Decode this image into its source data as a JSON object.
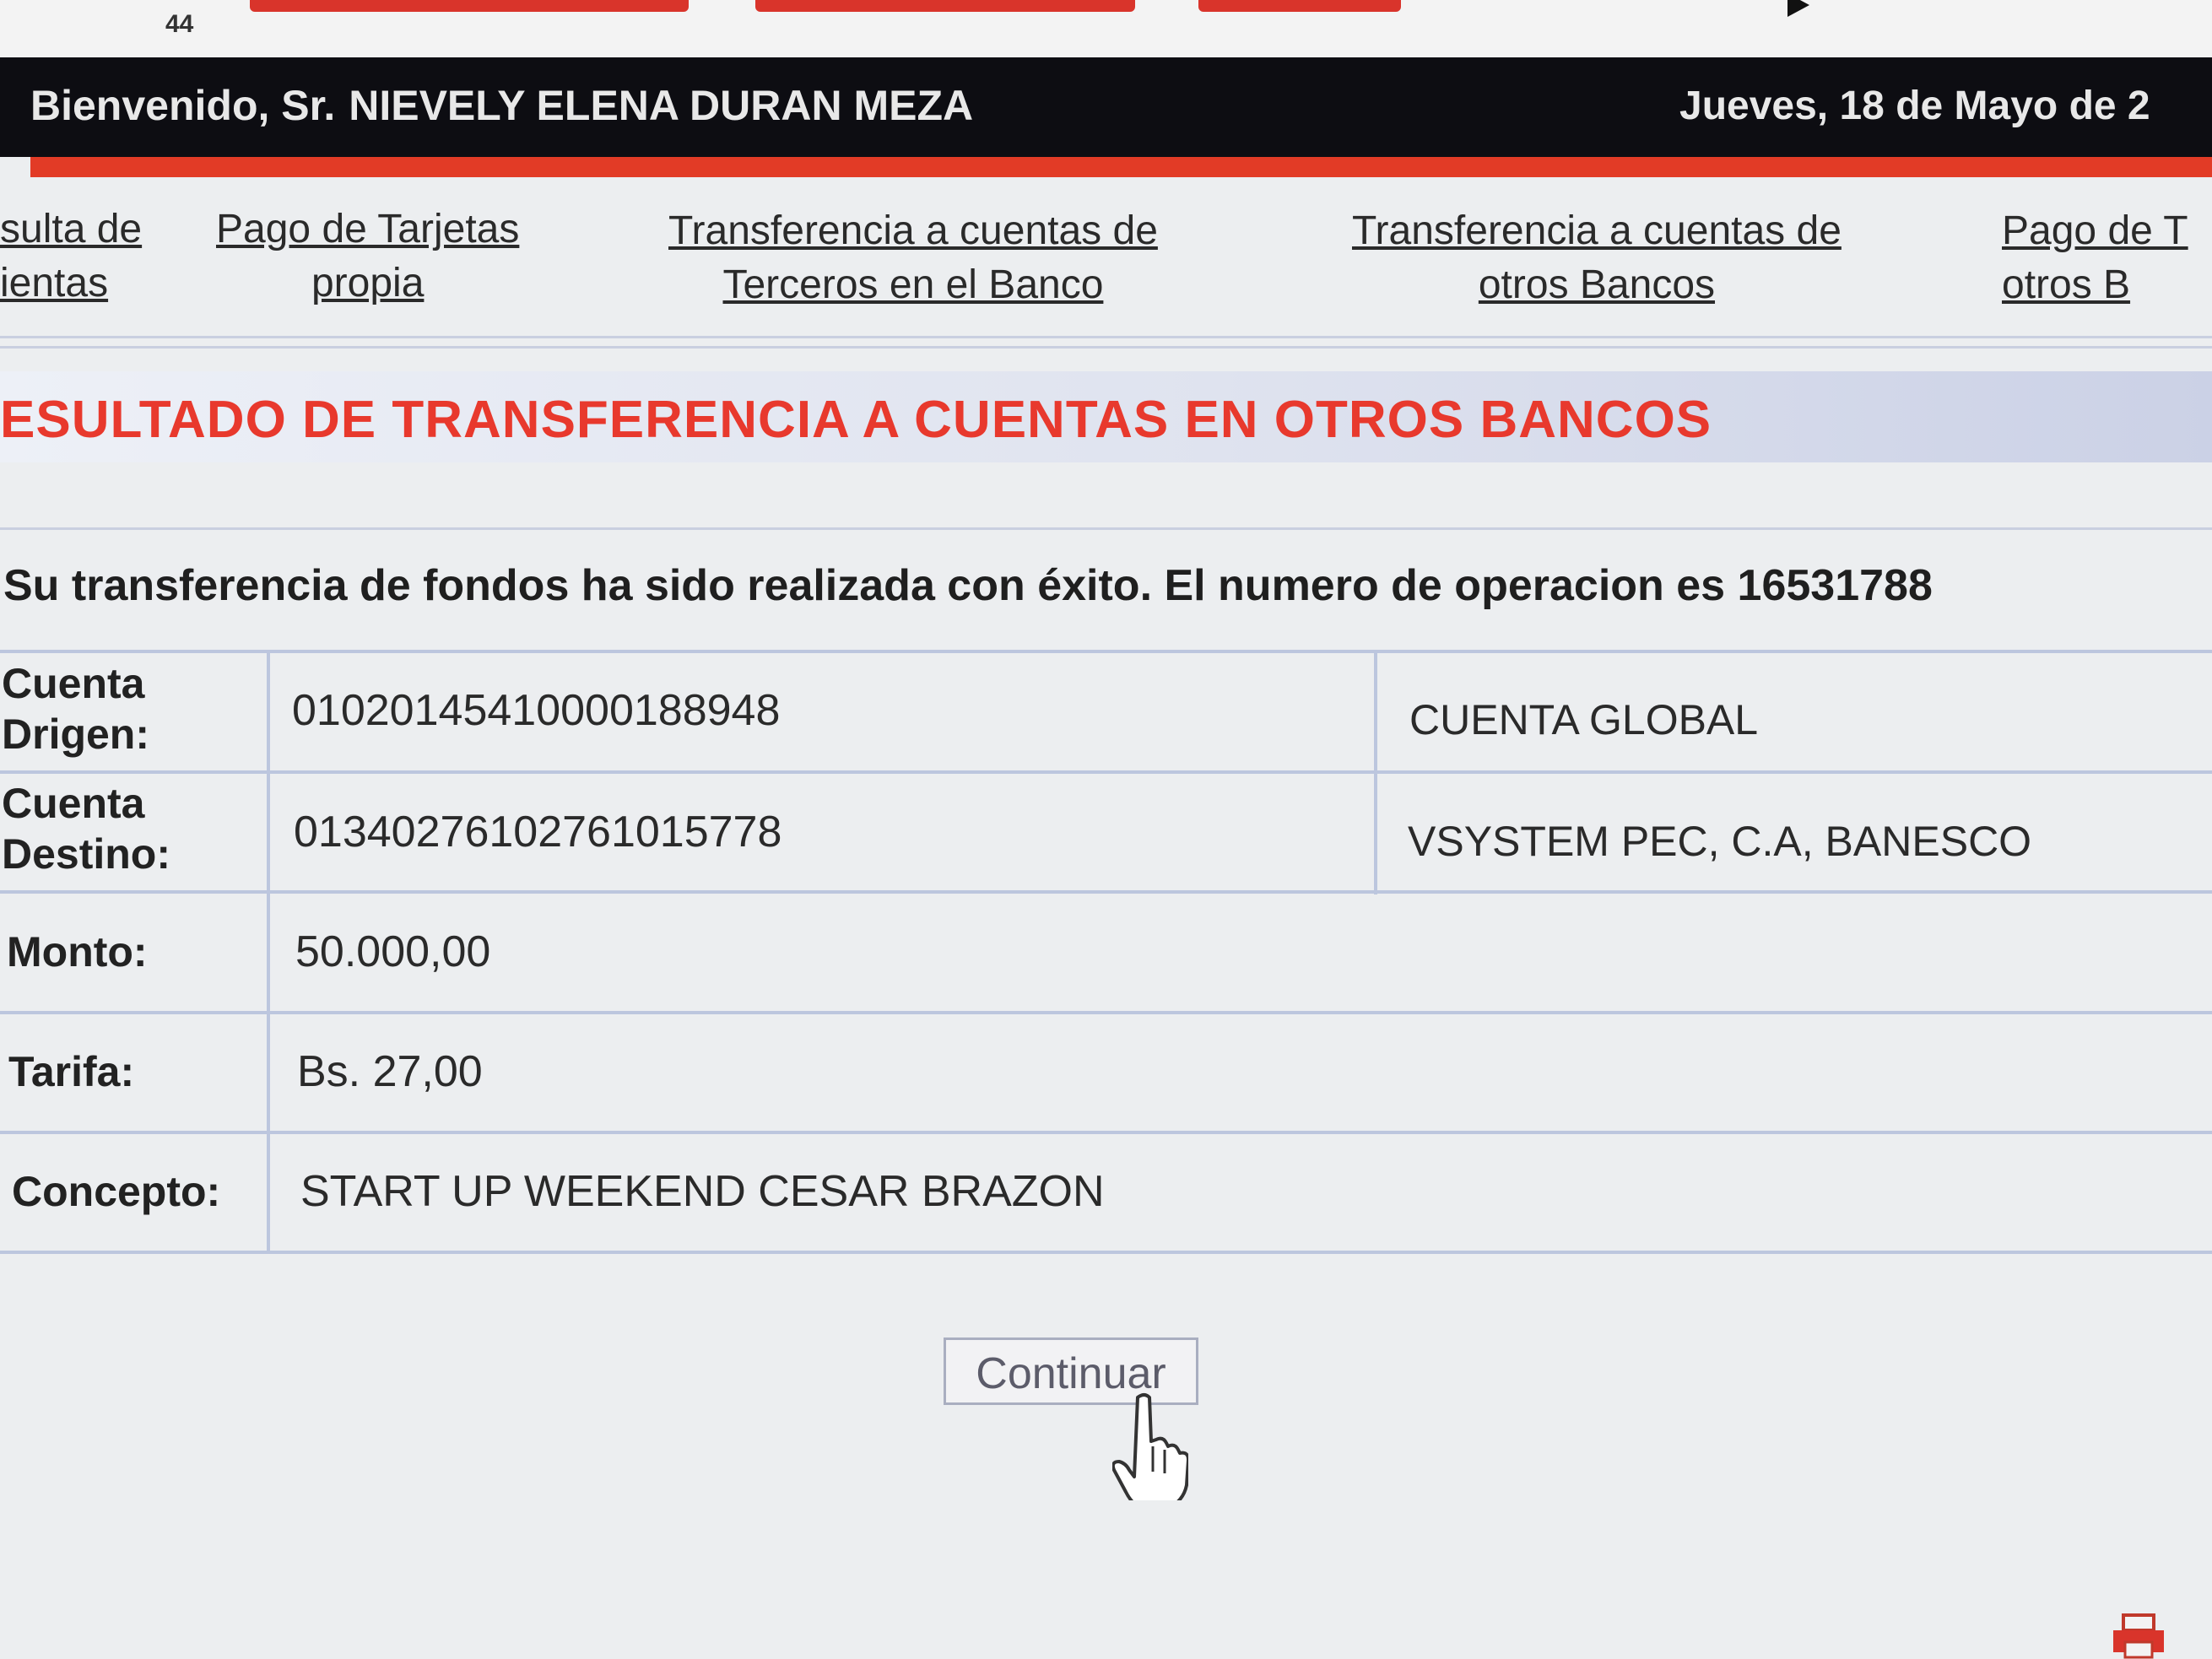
{
  "browser": {
    "tab_count": "44"
  },
  "header": {
    "welcome_prefix": "Bienvenido, Sr.",
    "user_name": "NIEVELY ELENA DURAN MEZA",
    "date": "Jueves, 18 de Mayo de 2"
  },
  "nav": {
    "items": [
      {
        "line1": "sulta de",
        "line2": "ientas"
      },
      {
        "line1": "Pago de Tarjetas",
        "line2": "propia"
      },
      {
        "line1": "Transferencia a cuentas de",
        "line2": "Terceros en el Banco"
      },
      {
        "line1": "Transferencia a cuentas de",
        "line2": "otros Bancos"
      },
      {
        "line1": "Pago de T",
        "line2": "otros B"
      }
    ]
  },
  "page": {
    "title": "ESULTADO DE TRANSFERENCIA A CUENTAS EN OTROS BANCOS",
    "success_message": "Su transferencia de fondos ha sido realizada con éxito. El numero de operacion es 16531788"
  },
  "details": {
    "origin_label_1": "Cuenta",
    "origin_label_2": "Drigen:",
    "origin_account": "01020145410000188948",
    "origin_account_name": "CUENTA GLOBAL",
    "dest_label_1": "Cuenta",
    "dest_label_2": "Destino:",
    "dest_account": "01340276102761015778",
    "dest_account_name": "VSYSTEM PEC, C.A, BANESCO",
    "amount_label": "Monto:",
    "amount": "50.000,00",
    "fee_label": "Tarifa:",
    "fee": "Bs. 27,00",
    "concept_label": "Concepto:",
    "concept": "START UP WEEKEND CESAR BRAZON"
  },
  "actions": {
    "continue_label": "Continuar"
  },
  "colors": {
    "accent_red": "#e23b26",
    "title_red": "#e8392d",
    "header_black": "#0d0d12",
    "table_border": "#bcc6de"
  }
}
